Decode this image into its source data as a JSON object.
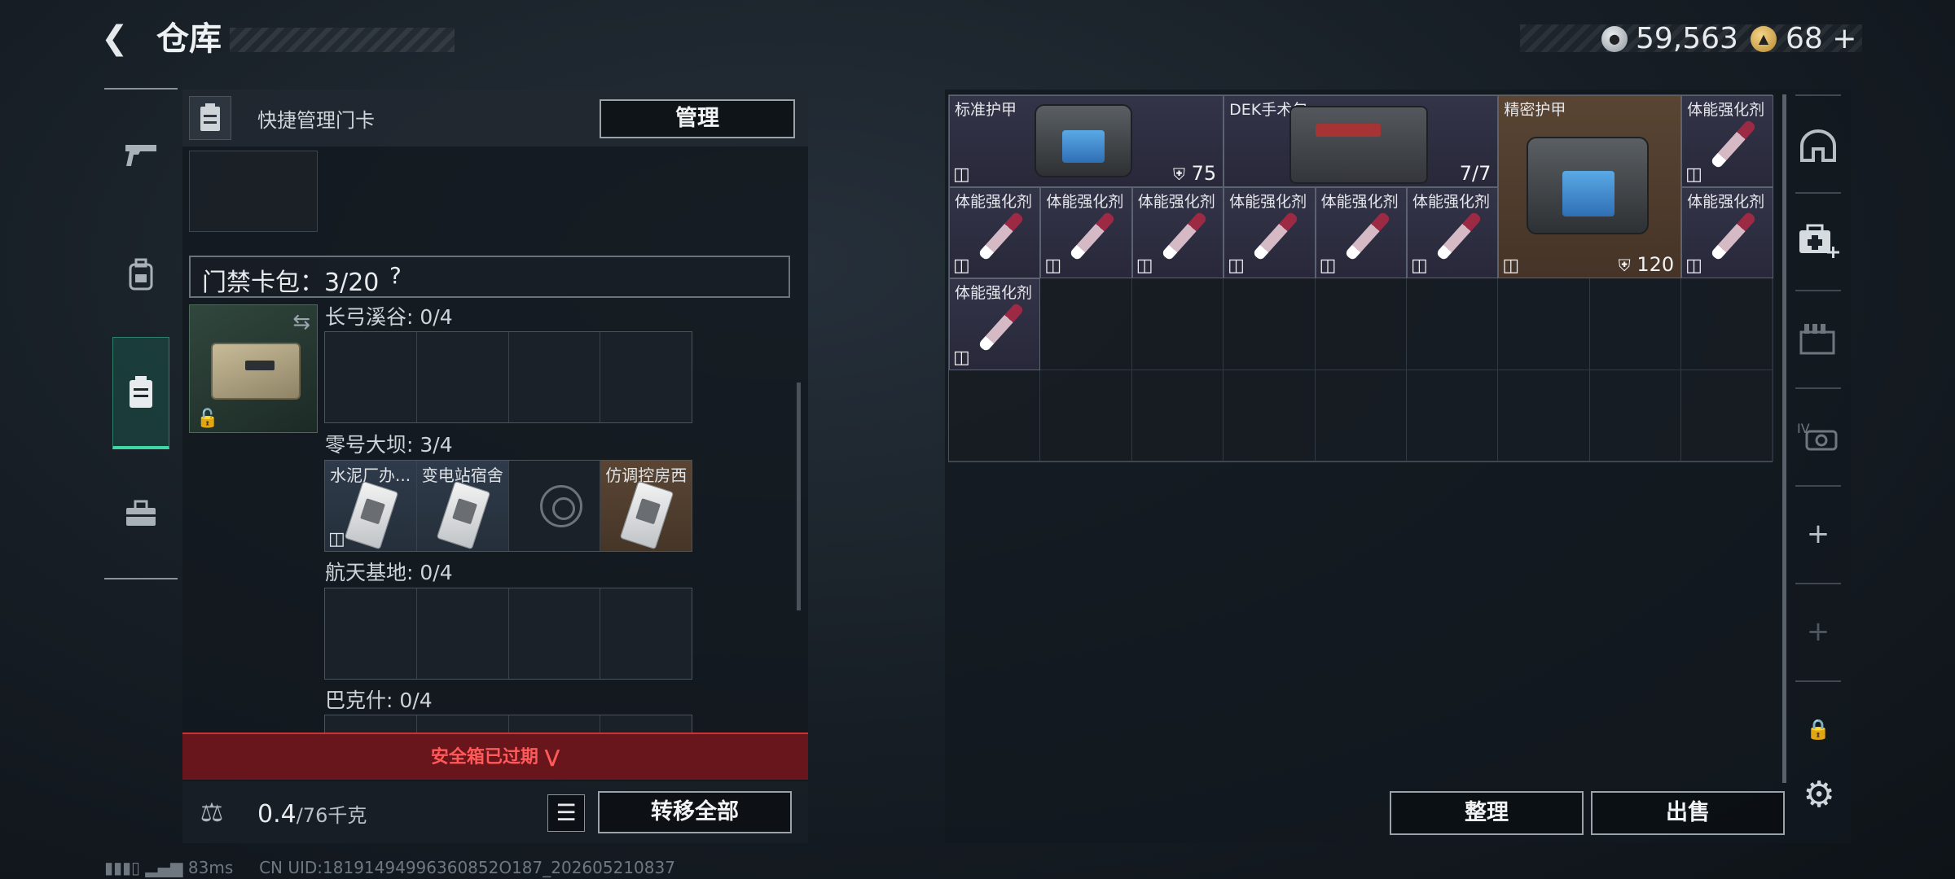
{
  "header": {
    "back_icon": "chevron-left-icon",
    "title": "仓库",
    "currency_silver": "59,563",
    "currency_gold": "68 +"
  },
  "left_tabs": [
    "pistol-icon",
    "backpack-icon",
    "card-holder-icon",
    "toolbox-icon"
  ],
  "left_panel": {
    "header_text": "快捷管理门卡",
    "manage_button": "管理",
    "keycard_pack_label": "门禁卡包：3/20",
    "help": "?",
    "zones": [
      {
        "label": "长弓溪谷: 0/4"
      },
      {
        "label": "零号大坝: 3/4",
        "cards": [
          "水泥厂办...",
          "变电站宿舍",
          "",
          "仿调控房西"
        ]
      },
      {
        "label": "航天基地: 0/4"
      },
      {
        "label": "巴克什: 0/4"
      }
    ],
    "expired_banner": "安全箱已过期",
    "weight_value": "0.4",
    "weight_max": "/76千克",
    "transfer_all_button": "转移全部",
    "status_ping": "83ms",
    "status_uid": "CN UID:18191494996360852O187_202605210837"
  },
  "stash": {
    "items": [
      {
        "name": "标准护甲",
        "qty": "75",
        "shield": true
      },
      {
        "name": "DEK手术包",
        "qty": "7/7"
      },
      {
        "name": "精密护甲",
        "qty": "120",
        "shield": true
      },
      {
        "name": "体能强化剂"
      }
    ],
    "syringe_name": "体能强化剂"
  },
  "right_tabs": [
    "helmet-icon",
    "medkit-add-icon",
    "ammo-crate-icon",
    "armor-iv-icon",
    "+",
    "+",
    "lock-icon"
  ],
  "buttons": {
    "sort": "整理",
    "sell": "出售"
  },
  "colors": {
    "accent_green": "#3fd7a6",
    "expired_red": "#ff5a5a",
    "item_purple": "#343449",
    "item_brown": "#5a4534"
  }
}
